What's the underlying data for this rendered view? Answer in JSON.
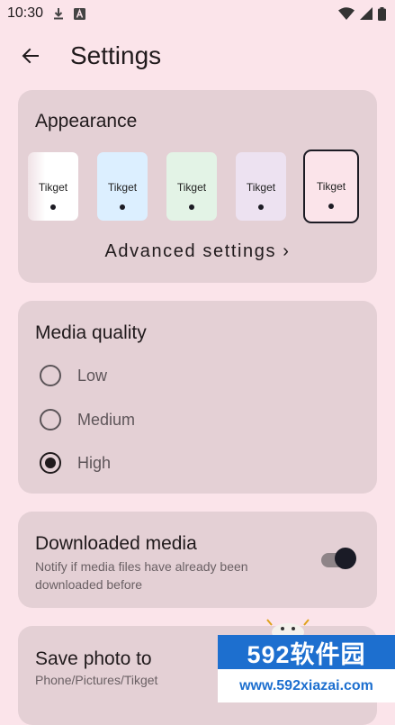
{
  "status_bar": {
    "time": "10:30",
    "icons": [
      "download-icon",
      "a-badge-icon",
      "wifi-icon",
      "signal-icon",
      "battery-icon"
    ]
  },
  "header": {
    "back_icon": "arrow-left-icon",
    "title": "Settings"
  },
  "appearance": {
    "title": "Appearance",
    "themes": [
      {
        "label": "Tikget",
        "color": "#ffffff",
        "selected": false
      },
      {
        "label": "Tikget",
        "color": "#dcefff",
        "selected": false
      },
      {
        "label": "Tikget",
        "color": "#e3f3e6",
        "selected": false
      },
      {
        "label": "Tikget",
        "color": "#ede2f1",
        "selected": false
      },
      {
        "label": "Tikget",
        "color": "#fbe4ea",
        "selected": true
      }
    ],
    "advanced_label": "Advanced settings ›"
  },
  "media_quality": {
    "title": "Media quality",
    "options": [
      {
        "label": "Low",
        "checked": false
      },
      {
        "label": "Medium",
        "checked": false
      },
      {
        "label": "High",
        "checked": true
      }
    ]
  },
  "downloaded_media": {
    "title": "Downloaded media",
    "subtitle": "Notify if media files have already been downloaded before",
    "enabled": true
  },
  "save_photo": {
    "title": "Save photo to",
    "path": "Phone/Pictures/Tikget"
  },
  "watermark": {
    "brand": "592软件园",
    "url": "www.592xiazai.com"
  },
  "colors": {
    "background": "#fbe4ea",
    "card": "#e4d0d5",
    "accent": "#1a1b26"
  }
}
